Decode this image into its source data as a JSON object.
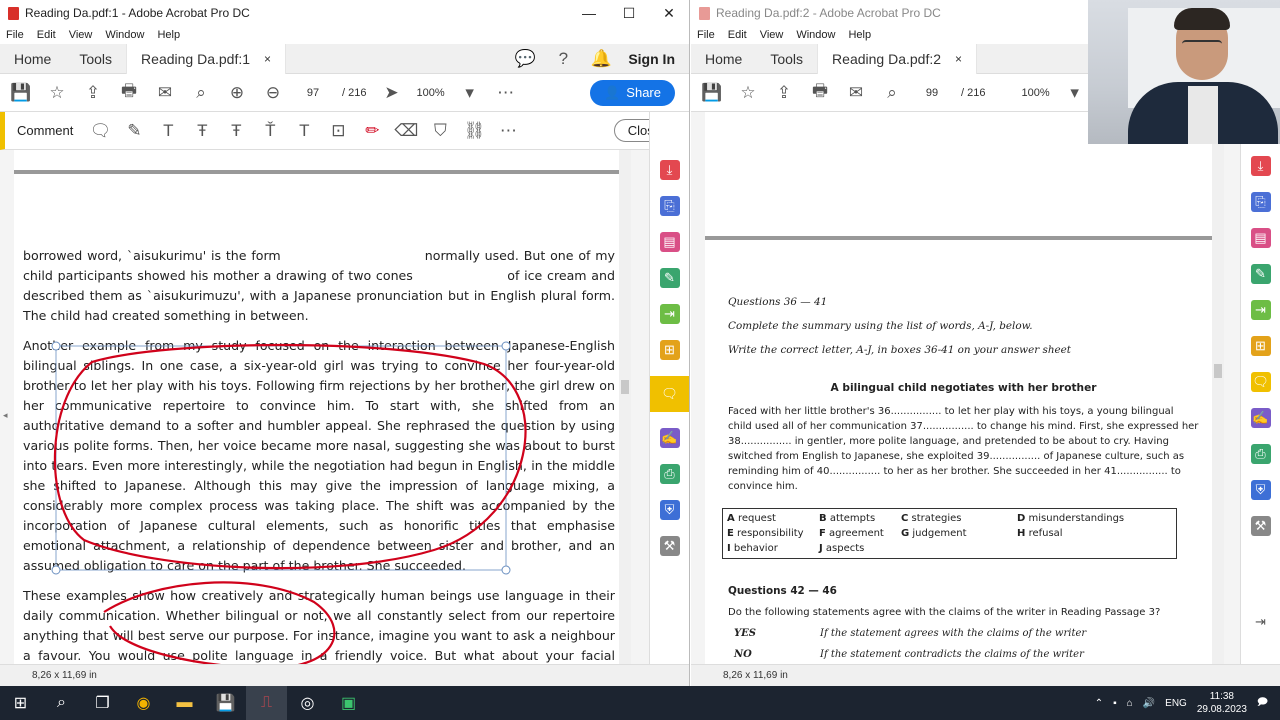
{
  "left_window": {
    "title": "Reading Da.pdf:1 - Adobe Acrobat Pro DC",
    "window_controls": [
      "—",
      "☐",
      "✕"
    ],
    "menu": [
      "File",
      "Edit",
      "View",
      "Window",
      "Help"
    ],
    "tabs": {
      "home": "Home",
      "tools": "Tools",
      "doc": "Reading Da.pdf:1",
      "close": "×"
    },
    "sign_in": "Sign In",
    "page_current": "97",
    "page_total": "/ 216",
    "zoom": "100%",
    "share_label": "Share",
    "comment_label": "Comment",
    "close_label": "Close",
    "status_size": "8,26 x 11,69 in",
    "paragraphs": [
      "borrowed word, `aisukurimu' is the form                              normally used. But one of my child participants showed his mother a drawing of two cones                    of ice cream and described them as `aisukurimuzu', with a Japanese pronunciation but in English plural form. The child had created something in between.",
      "Another example from my study focused on the interaction between Japanese-English bilingual siblings. In one case, a six-year-old girl was trying to convince her four-year-old brother to let her play with his toys. Following firm rejections by her brother, the girl drew on her communicative repertoire to convince him. To start with, she shifted from an authoritative demand to a softer and humbler appeal. She rephrased the question by using various polite forms. Then, her voice became more nasal, suggesting she was about to burst into tears. Even more interestingly, while the negotiation had begun in English, in the middle she shifted to Japanese. Although this may give the impression of language mixing, a considerably more complex process was taking place. The shift was accompanied by the incorporation of Japanese cultural elements, such as honorific titles that emphasise emotional attachment, a relationship of dependence between sister and brother, and an assumed obligation to care on the part of the brother. She succeeded.",
      "These examples show how creatively and strategically human beings use language in their daily communication. Whether bilingual or not, we all constantly select from our repertoire anything that will best serve our purpose. For instance, imagine you want to ask a neighbour a favour. You would use polite language in a friendly voice. But what about your facial expression? Your"
    ]
  },
  "right_window": {
    "title": "Reading Da.pdf:2 - Adobe Acrobat Pro DC",
    "menu": [
      "File",
      "Edit",
      "View",
      "Window",
      "Help"
    ],
    "tabs": {
      "home": "Home",
      "tools": "Tools",
      "doc": "Reading Da.pdf:2",
      "close": "×"
    },
    "page_current": "99",
    "page_total": "/ 216",
    "zoom": "100%",
    "status_size": "8,26 x 11,69 in",
    "q1_heading": "Questions 36 — 41",
    "q1_instr1": "Complete the summary using the list of words, A-J, below.",
    "q1_instr2": "Write the correct letter, A-J, in boxes 36-41 on your answer sheet",
    "summary_title": "A bilingual child negotiates with her brother",
    "summary_text": "Faced with her little brother's 36................ to let her play with his toys, a young bilingual child used all of her communication 37................ to change his mind. First, she expressed her 38................ in gentler, more polite language, and pretended to be about to cry. Having switched from English to Japanese, she exploited 39................ of Japanese culture, such as reminding him of 40................   to her as her brother. She succeeded in her 41................ to convince him.",
    "word_list": [
      [
        "A",
        "request"
      ],
      [
        "B",
        "attempts"
      ],
      [
        "C",
        "strategies"
      ],
      [
        "D",
        "misunderstandings"
      ],
      [
        "E",
        "responsibility"
      ],
      [
        "F",
        "agreement"
      ],
      [
        "G",
        "judgement"
      ],
      [
        "H",
        "refusal"
      ],
      [
        "I",
        "behavior"
      ],
      [
        "J",
        "aspects"
      ],
      [
        "",
        ""
      ],
      [
        "",
        ""
      ]
    ],
    "q2_heading": "Questions 42 — 46",
    "q2_instr": "Do the following statements agree with the claims of the writer in Reading Passage 3?",
    "yes_key": "YES",
    "yes_text": "If the statement agrees with the claims of the writer",
    "no_key": "NO",
    "no_text": "If the statement contradicts the claims of the writer"
  },
  "taskbar": {
    "language": "ENG",
    "time": "11:38",
    "date": "29.08.2023"
  },
  "colors": {
    "accent_blue": "#1473e6",
    "annotation_red": "#d0021b",
    "comment_yellow": "#f0c000"
  }
}
